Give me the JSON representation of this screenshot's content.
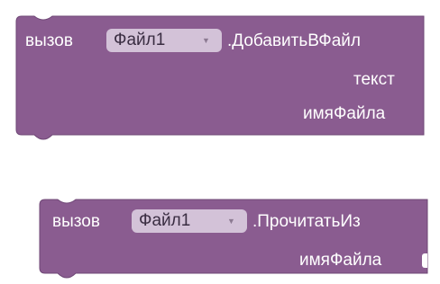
{
  "blocks": [
    {
      "call_label": "вызов",
      "component": "Файл1",
      "method": ".ДобавитьВФайл",
      "params": [
        "текст",
        "имяФайла"
      ]
    },
    {
      "call_label": "вызов",
      "component": "Файл1",
      "method": ".ПрочитатьИз",
      "params": [
        "имяФайла"
      ]
    }
  ],
  "colors": {
    "block_fill": "#8a5c90",
    "block_edge": "#6f4776",
    "dropdown_fill": "#d3c2d8"
  },
  "icons": {
    "dropdown": "chevron-down-icon",
    "socket": "input-socket-icon"
  }
}
